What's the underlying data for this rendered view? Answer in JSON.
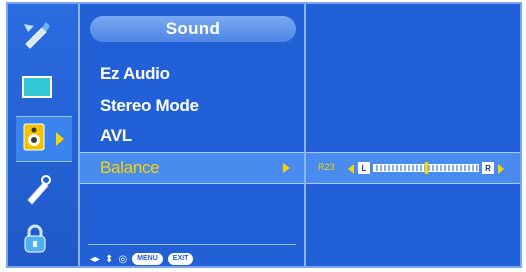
{
  "sidebar": {
    "icons": [
      {
        "name": "picture-icon"
      },
      {
        "name": "screen-icon"
      },
      {
        "name": "sound-icon",
        "selected": true
      },
      {
        "name": "option-icon"
      },
      {
        "name": "lock-icon"
      }
    ]
  },
  "menu": {
    "title": "Sound",
    "items": [
      {
        "label": "Ez Audio"
      },
      {
        "label": "Stereo Mode"
      },
      {
        "label": "AVL"
      },
      {
        "label": "Balance",
        "selected": true
      }
    ]
  },
  "balance": {
    "value_label": "R23",
    "left_box": "L",
    "right_box": "R",
    "position": 0.5
  },
  "footer": {
    "menu_label": "MENU",
    "exit_label": "EXIT"
  },
  "colors": {
    "background": "#2160d6",
    "highlight": "#4a8bef",
    "selected_text": "#f3d500"
  }
}
